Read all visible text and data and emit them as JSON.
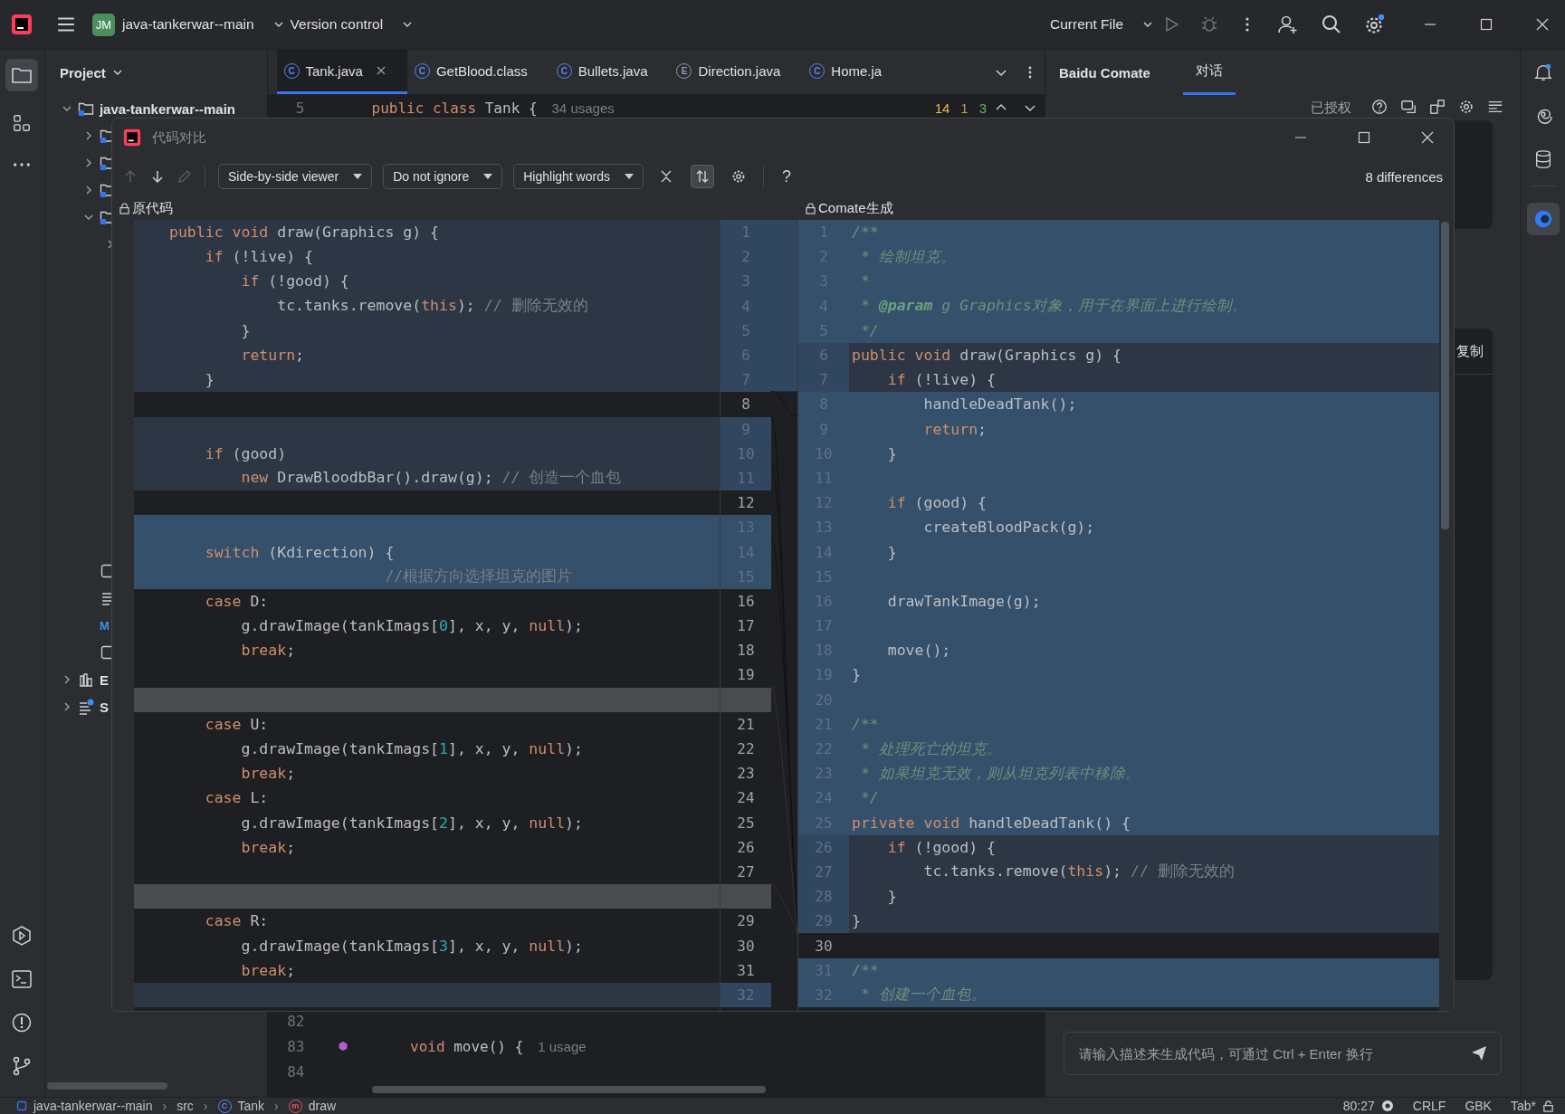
{
  "title_bar": {
    "project_initials": "JM",
    "project": "java-tankerwar--main",
    "vcs": "Version control",
    "run_config": "Current File"
  },
  "project_panel": {
    "title": "Project",
    "tree": [
      {
        "kind": "folder",
        "label": "java-tankerwar--main",
        "expanded": true,
        "children": [
          {
            "kind": "folder",
            "expanded": false
          },
          {
            "kind": "folder",
            "expanded": false
          },
          {
            "kind": "folder",
            "expanded": false
          },
          {
            "kind": "folder",
            "expanded": true,
            "children": [
              {
                "expanded": false
              }
            ]
          },
          {
            "kind": "file"
          },
          {
            "kind": "list"
          },
          {
            "kind": "maven",
            "label": "M"
          },
          {
            "kind": "file"
          }
        ]
      },
      {
        "kind": "libraries",
        "label": "E",
        "expanded": false
      },
      {
        "kind": "scratches",
        "label": "S",
        "expanded": false
      }
    ]
  },
  "editor": {
    "tabs": [
      {
        "icon": "C",
        "label": "Tank.java",
        "selected": true
      },
      {
        "icon": "C",
        "label": "GetBlood.class",
        "selected": false
      },
      {
        "icon": "C",
        "label": "Bullets.java",
        "selected": false
      },
      {
        "icon": "E",
        "label": "Direction.java",
        "selected": false
      },
      {
        "icon": "C",
        "label": "Home.ja",
        "selected": false
      }
    ],
    "top_line": {
      "num": "5",
      "code": [
        {
          "kind": "kw",
          "text": "public class "
        },
        {
          "kind": "p",
          "text": "Tank {"
        }
      ],
      "hint": "34 usages"
    },
    "inspections": [
      {
        "kind": "warning",
        "count": "14"
      },
      {
        "kind": "weak",
        "count": "1"
      },
      {
        "kind": "ok",
        "count": "3"
      }
    ],
    "bottom_lines": [
      {
        "num": "82",
        "marker": false
      },
      {
        "num": "83",
        "marker": true,
        "code": [
          {
            "kind": "kw",
            "text": "    void "
          },
          {
            "kind": "p",
            "text": "move() {"
          }
        ],
        "hint": "1 usage"
      },
      {
        "num": "84",
        "marker": false
      }
    ]
  },
  "comate": {
    "title": "Baidu Comate",
    "tabs": [
      {
        "label": "对话",
        "selected": true
      }
    ],
    "status": "已授权",
    "copy": "复制",
    "input_placeholder": "请输入描述来生成代码，可通过 Ctrl + Enter 换行"
  },
  "status_bar": {
    "separator": "›",
    "breadcrumbs": [
      {
        "kind": "module",
        "label": "java-tankerwar--main"
      },
      {
        "kind": "folder",
        "label": "src"
      },
      {
        "kind": "class",
        "icon": "C",
        "label": "Tank"
      },
      {
        "kind": "method",
        "icon": "m",
        "label": "draw"
      }
    ],
    "position": "80:27",
    "line_separator": "CRLF",
    "encoding": "GBK",
    "indent": "Tab*"
  },
  "dialog": {
    "title": "代码对比",
    "nav": [
      {
        "kind": "up",
        "disabled": true
      },
      {
        "kind": "down",
        "disabled": false
      },
      {
        "kind": "edit",
        "disabled": true
      }
    ],
    "dropdowns": [
      "Side-by-side viewer",
      "Do not ignore",
      "Highlight words"
    ],
    "toggles": [
      {
        "kind": "collapse",
        "selected": false
      },
      {
        "kind": "sync",
        "selected": true
      },
      {
        "kind": "settings",
        "selected": false
      }
    ],
    "help": "?",
    "summary": "8 differences",
    "left_title": "原代码",
    "right_title": "Comate生成",
    "left_rows": [
      {
        "kind": "modified",
        "num": "1",
        "code": [
          {
            "kind": "kw",
            "text": "public void "
          },
          {
            "kind": "p",
            "text": "draw(Graphics g) {"
          }
        ]
      },
      {
        "kind": "modified",
        "num": "2",
        "code": [
          {
            "kind": "kw",
            "text": "    if"
          },
          {
            "kind": "p",
            "text": " (!live) {"
          }
        ]
      },
      {
        "kind": "modified",
        "num": "3",
        "code": [
          {
            "kind": "kw",
            "text": "        if"
          },
          {
            "kind": "p",
            "text": " (!good) {"
          }
        ]
      },
      {
        "kind": "modified",
        "num": "4",
        "code": [
          {
            "kind": "p",
            "text": "            tc.tanks.remove("
          },
          {
            "kind": "kw",
            "text": "this"
          },
          {
            "kind": "p",
            "text": "); "
          },
          {
            "kind": "cm",
            "text": "// 删除无效的"
          }
        ]
      },
      {
        "kind": "modified",
        "num": "5",
        "code": [
          {
            "kind": "p",
            "text": "        }"
          }
        ]
      },
      {
        "kind": "modified",
        "num": "6",
        "code": [
          {
            "kind": "kw",
            "text": "        return"
          },
          {
            "kind": "p",
            "text": ";"
          }
        ]
      },
      {
        "kind": "modified",
        "num": "7",
        "code": [
          {
            "kind": "p",
            "text": "    }"
          }
        ]
      },
      {
        "kind": "plain",
        "num": "8"
      },
      {
        "kind": "modified",
        "num": "9"
      },
      {
        "kind": "modified",
        "num": "10",
        "code": [
          {
            "kind": "kw",
            "text": "    if"
          },
          {
            "kind": "p",
            "text": " (good)"
          }
        ]
      },
      {
        "kind": "modified",
        "num": "11",
        "code": [
          {
            "kind": "kw",
            "text": "        new "
          },
          {
            "kind": "p",
            "text": "DrawBloodbBar().draw(g); "
          },
          {
            "kind": "cm",
            "text": "// 创造一个血包"
          }
        ]
      },
      {
        "kind": "plain",
        "num": "12"
      },
      {
        "kind": "changed",
        "num": "13"
      },
      {
        "kind": "changed",
        "num": "14",
        "code": [
          {
            "kind": "kw",
            "text": "    switch"
          },
          {
            "kind": "p",
            "text": " (Kdirection) {"
          }
        ]
      },
      {
        "kind": "changed",
        "num": "15",
        "code": [
          {
            "kind": "cm",
            "text": "                        //根据方向选择坦克的图片"
          }
        ]
      },
      {
        "kind": "plain",
        "num": "16",
        "code": [
          {
            "kind": "kw",
            "text": "    case "
          },
          {
            "kind": "p",
            "text": "D:"
          }
        ]
      },
      {
        "kind": "plain",
        "num": "17",
        "code": [
          {
            "kind": "p",
            "text": "        g.drawImage(tankImags["
          },
          {
            "kind": "num",
            "text": "0"
          },
          {
            "kind": "p",
            "text": "], x, y, "
          },
          {
            "kind": "kw",
            "text": "null"
          },
          {
            "kind": "p",
            "text": ");"
          }
        ]
      },
      {
        "kind": "plain",
        "num": "18",
        "code": [
          {
            "kind": "kw",
            "text": "        break"
          },
          {
            "kind": "p",
            "text": ";"
          }
        ]
      },
      {
        "kind": "plain",
        "num": "19"
      },
      {
        "kind": "filler"
      },
      {
        "kind": "plain",
        "num": "21",
        "code": [
          {
            "kind": "kw",
            "text": "    case "
          },
          {
            "kind": "p",
            "text": "U:"
          }
        ]
      },
      {
        "kind": "plain",
        "num": "22",
        "code": [
          {
            "kind": "p",
            "text": "        g.drawImage(tankImags["
          },
          {
            "kind": "num",
            "text": "1"
          },
          {
            "kind": "p",
            "text": "], x, y, "
          },
          {
            "kind": "kw",
            "text": "null"
          },
          {
            "kind": "p",
            "text": ");"
          }
        ]
      },
      {
        "kind": "plain",
        "num": "23",
        "code": [
          {
            "kind": "kw",
            "text": "        break"
          },
          {
            "kind": "p",
            "text": ";"
          }
        ]
      },
      {
        "kind": "plain",
        "num": "24",
        "code": [
          {
            "kind": "kw",
            "text": "    case "
          },
          {
            "kind": "p",
            "text": "L:"
          }
        ]
      },
      {
        "kind": "plain",
        "num": "25",
        "code": [
          {
            "kind": "p",
            "text": "        g.drawImage(tankImags["
          },
          {
            "kind": "num",
            "text": "2"
          },
          {
            "kind": "p",
            "text": "], x, y, "
          },
          {
            "kind": "kw",
            "text": "null"
          },
          {
            "kind": "p",
            "text": ");"
          }
        ]
      },
      {
        "kind": "plain",
        "num": "26",
        "code": [
          {
            "kind": "kw",
            "text": "        break"
          },
          {
            "kind": "p",
            "text": ";"
          }
        ]
      },
      {
        "kind": "plain",
        "num": "27"
      },
      {
        "kind": "filler"
      },
      {
        "kind": "plain",
        "num": "29",
        "code": [
          {
            "kind": "kw",
            "text": "    case "
          },
          {
            "kind": "p",
            "text": "R:"
          }
        ]
      },
      {
        "kind": "plain",
        "num": "30",
        "code": [
          {
            "kind": "p",
            "text": "        g.drawImage(tankImags["
          },
          {
            "kind": "num",
            "text": "3"
          },
          {
            "kind": "p",
            "text": "], x, y, "
          },
          {
            "kind": "kw",
            "text": "null"
          },
          {
            "kind": "p",
            "text": ");"
          }
        ]
      },
      {
        "kind": "plain",
        "num": "31",
        "code": [
          {
            "kind": "kw",
            "text": "        break"
          },
          {
            "kind": "p",
            "text": ";"
          }
        ]
      },
      {
        "kind": "modified",
        "num": "32"
      }
    ],
    "right_rows": [
      {
        "kind": "changed",
        "num": "1",
        "code": [
          {
            "kind": "doc",
            "text": "/**"
          }
        ]
      },
      {
        "kind": "changed",
        "num": "2",
        "code": [
          {
            "kind": "doc",
            "text": " * 绘制坦克。"
          }
        ]
      },
      {
        "kind": "changed",
        "num": "3",
        "code": [
          {
            "kind": "doc",
            "text": " *"
          }
        ]
      },
      {
        "kind": "changed",
        "num": "4",
        "code": [
          {
            "kind": "doc",
            "text": " * "
          },
          {
            "kind": "tag",
            "text": "@param"
          },
          {
            "kind": "doc",
            "text": " g Graphics对象，用于在界面上进行绘制。"
          }
        ]
      },
      {
        "kind": "changed",
        "num": "5",
        "code": [
          {
            "kind": "doc",
            "text": " */"
          }
        ]
      },
      {
        "kind": "modified",
        "num": "6",
        "code": [
          {
            "kind": "kw",
            "text": "public void "
          },
          {
            "kind": "p",
            "text": "draw(Graphics g) {"
          }
        ]
      },
      {
        "kind": "modified",
        "num": "7",
        "code": [
          {
            "kind": "kw",
            "text": "    if"
          },
          {
            "kind": "p",
            "text": " (!live) {"
          }
        ]
      },
      {
        "kind": "changed",
        "num": "8",
        "code": [
          {
            "kind": "p",
            "text": "        handleDeadTank();"
          }
        ]
      },
      {
        "kind": "changed",
        "num": "9",
        "code": [
          {
            "kind": "kw",
            "text": "        return"
          },
          {
            "kind": "p",
            "text": ";"
          }
        ]
      },
      {
        "kind": "changed",
        "num": "10",
        "code": [
          {
            "kind": "p",
            "text": "    }"
          }
        ]
      },
      {
        "kind": "changed",
        "num": "11"
      },
      {
        "kind": "changed",
        "num": "12",
        "code": [
          {
            "kind": "kw",
            "text": "    if"
          },
          {
            "kind": "p",
            "text": " (good) {"
          }
        ]
      },
      {
        "kind": "changed",
        "num": "13",
        "code": [
          {
            "kind": "p",
            "text": "        createBloodPack(g);"
          }
        ]
      },
      {
        "kind": "changed",
        "num": "14",
        "code": [
          {
            "kind": "p",
            "text": "    }"
          }
        ]
      },
      {
        "kind": "changed",
        "num": "15"
      },
      {
        "kind": "changed",
        "num": "16",
        "code": [
          {
            "kind": "p",
            "text": "    drawTankImage(g);"
          }
        ]
      },
      {
        "kind": "changed",
        "num": "17"
      },
      {
        "kind": "changed",
        "num": "18",
        "code": [
          {
            "kind": "p",
            "text": "    move();"
          }
        ]
      },
      {
        "kind": "changed",
        "num": "19",
        "code": [
          {
            "kind": "p",
            "text": "}"
          }
        ]
      },
      {
        "kind": "changed",
        "num": "20"
      },
      {
        "kind": "changed",
        "num": "21",
        "code": [
          {
            "kind": "doc",
            "text": "/**"
          }
        ]
      },
      {
        "kind": "changed",
        "num": "22",
        "code": [
          {
            "kind": "doc",
            "text": " * 处理死亡的坦克。"
          }
        ]
      },
      {
        "kind": "changed",
        "num": "23",
        "code": [
          {
            "kind": "doc",
            "text": " * 如果坦克无效，则从坦克列表中移除。"
          }
        ]
      },
      {
        "kind": "changed",
        "num": "24",
        "code": [
          {
            "kind": "doc",
            "text": " */"
          }
        ]
      },
      {
        "kind": "changed",
        "num": "25",
        "code": [
          {
            "kind": "kw",
            "text": "private void "
          },
          {
            "kind": "p",
            "text": "handleDeadTank() {"
          }
        ]
      },
      {
        "kind": "modified",
        "num": "26",
        "code": [
          {
            "kind": "kw",
            "text": "    if"
          },
          {
            "kind": "p",
            "text": " (!good) {"
          }
        ]
      },
      {
        "kind": "modified",
        "num": "27",
        "code": [
          {
            "kind": "p",
            "text": "        tc.tanks.remove("
          },
          {
            "kind": "kw",
            "text": "this"
          },
          {
            "kind": "p",
            "text": "); "
          },
          {
            "kind": "cm",
            "text": "// 删除无效的"
          }
        ]
      },
      {
        "kind": "modified",
        "num": "28",
        "code": [
          {
            "kind": "p",
            "text": "    }"
          }
        ]
      },
      {
        "kind": "modified",
        "num": "29",
        "code": [
          {
            "kind": "p",
            "text": "}"
          }
        ]
      },
      {
        "kind": "plain",
        "num": "30"
      },
      {
        "kind": "changed",
        "num": "31",
        "code": [
          {
            "kind": "doc",
            "text": "/**"
          }
        ]
      },
      {
        "kind": "changed",
        "num": "32",
        "code": [
          {
            "kind": "doc",
            "text": " * 创建一个血包。"
          }
        ]
      }
    ]
  }
}
